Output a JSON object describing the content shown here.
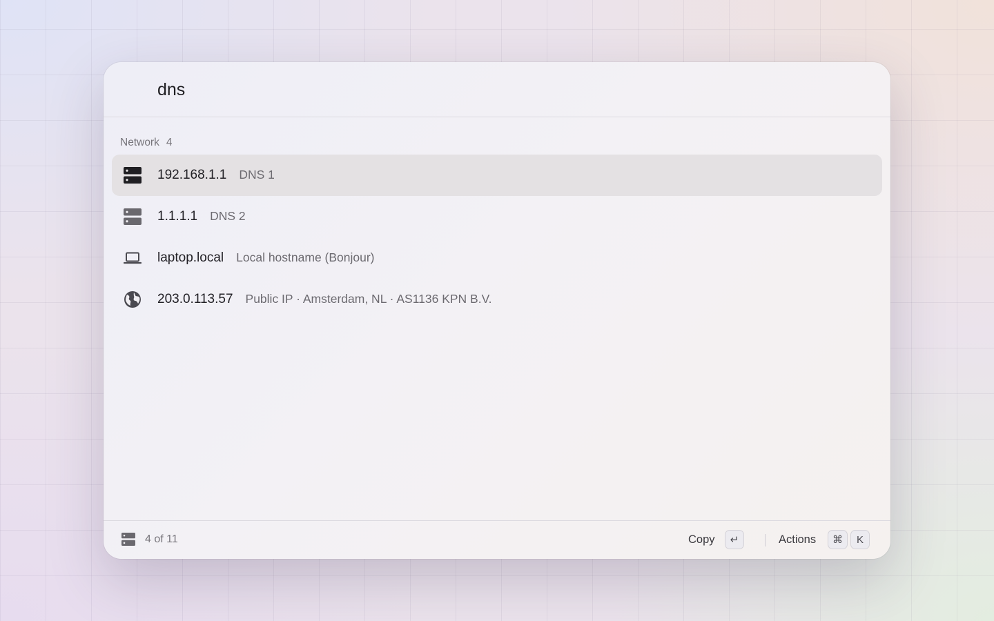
{
  "search": {
    "value": "dns"
  },
  "section": {
    "label": "Network",
    "count": "4"
  },
  "results": [
    {
      "title": "192.168.1.1",
      "subtitle": "DNS 1",
      "icon": "server-icon",
      "selected": true
    },
    {
      "title": "1.1.1.1",
      "subtitle": "DNS 2",
      "icon": "server-icon",
      "selected": false
    },
    {
      "title": "laptop.local",
      "subtitle": "Local hostname (Bonjour)",
      "icon": "laptop-icon",
      "selected": false
    },
    {
      "title": "203.0.113.57",
      "subtitle": "Public IP · Amsterdam, NL · AS1136 KPN B.V.",
      "icon": "globe-icon",
      "selected": false
    }
  ],
  "footer": {
    "icon": "server-icon",
    "count_text": "4 of 11",
    "copy_label": "Copy",
    "copy_key": "↵",
    "actions_label": "Actions",
    "actions_key_1": "⌘",
    "actions_key_2": "K"
  },
  "colors": {
    "selected_row": "#e4e1e3",
    "icon": "#2a292e",
    "secondary_text": "#6c6a70"
  }
}
